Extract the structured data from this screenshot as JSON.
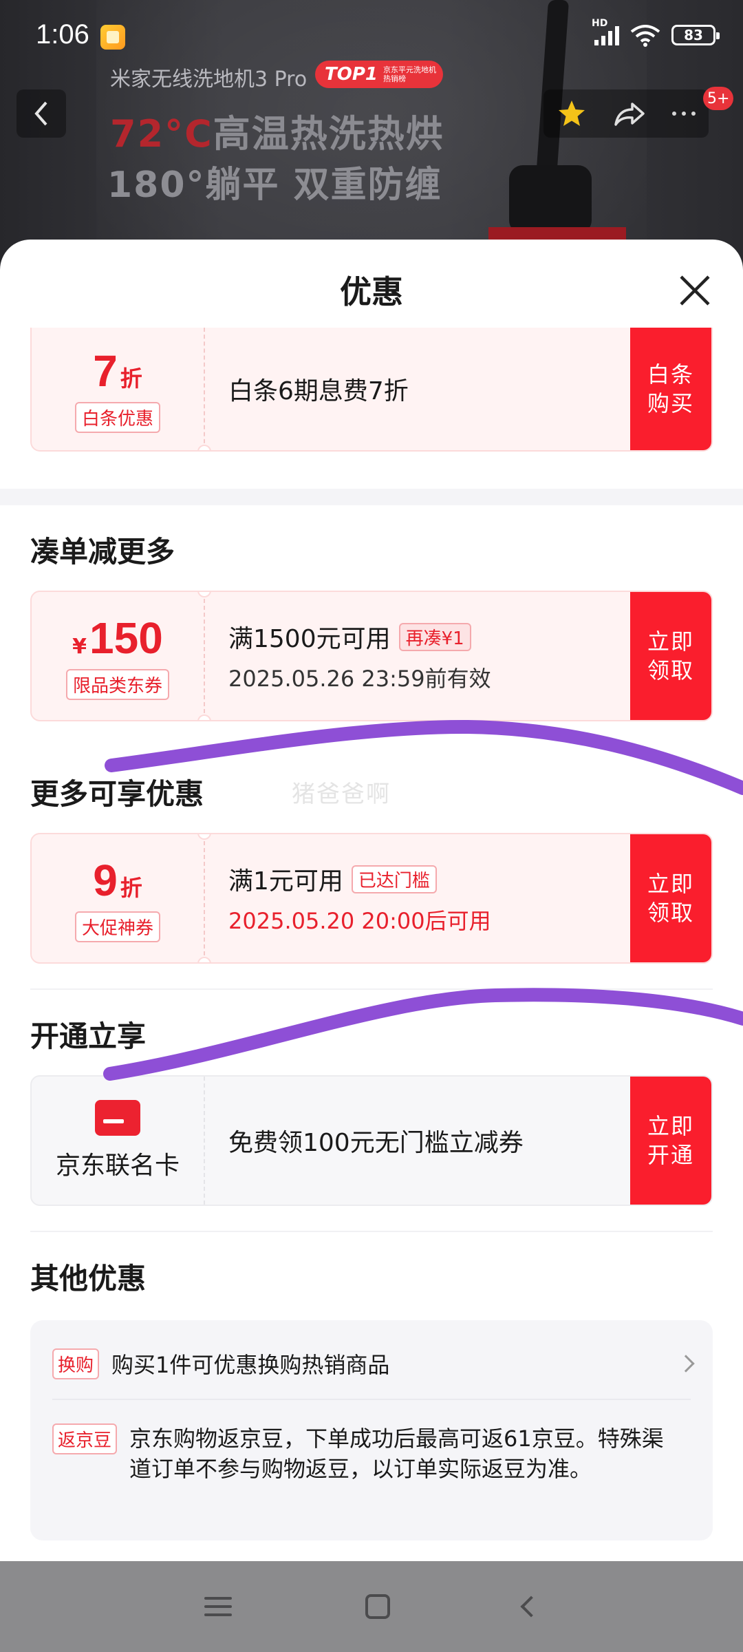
{
  "status_bar": {
    "time": "1:06",
    "network": "HD",
    "battery": "83"
  },
  "product_banner": {
    "name": "米家无线洗地机3 Pro",
    "badge_big": "TOP1",
    "badge_small_1": "京东平元洗地机",
    "badge_small_2": "热销榜",
    "hero_red": "72°C",
    "hero_rest": "高温热洗热烘",
    "hero_line2": "180°躺平 双重防缠",
    "cart_count": "5+"
  },
  "sheet": {
    "title": "优惠"
  },
  "coupon_baitiao": {
    "value": "7",
    "unit": "折",
    "tag": "白条优惠",
    "desc": "白条6期息费7折",
    "action_line1": "白条",
    "action_line2": "购买"
  },
  "section_more": {
    "title": "凑单减更多"
  },
  "coupon_150": {
    "currency": "¥",
    "value": "150",
    "tag": "限品类东券",
    "desc": "满1500元可用",
    "pill": "再凑¥1",
    "validity": "2025.05.26 23:59前有效",
    "action_line1": "立即",
    "action_line2": "领取"
  },
  "section_enjoy": {
    "title": "更多可享优惠"
  },
  "watermark": "猪爸爸啊",
  "coupon_9": {
    "value": "9",
    "unit": "折",
    "tag": "大促神券",
    "desc": "满1元可用",
    "pill": "已达门槛",
    "validity": "2025.05.20 20:00后可用",
    "action_line1": "立即",
    "action_line2": "领取"
  },
  "section_open": {
    "title": "开通立享"
  },
  "coupon_card": {
    "name": "京东联名卡",
    "desc": "免费领100元无门槛立减券",
    "action_line1": "立即",
    "action_line2": "开通"
  },
  "section_other": {
    "title": "其他优惠"
  },
  "other": {
    "row1_tag": "换购",
    "row1_text": "购买1件可优惠换购热销商品",
    "row2_tag": "返京豆",
    "row2_text": "京东购物返京豆，下单成功后最高可返61京豆。特殊渠道订单不参与购物返豆，以订单实际返豆为准。"
  },
  "colors": {
    "accent": "#fa1e2d",
    "annotation": "#8e4fd6"
  }
}
